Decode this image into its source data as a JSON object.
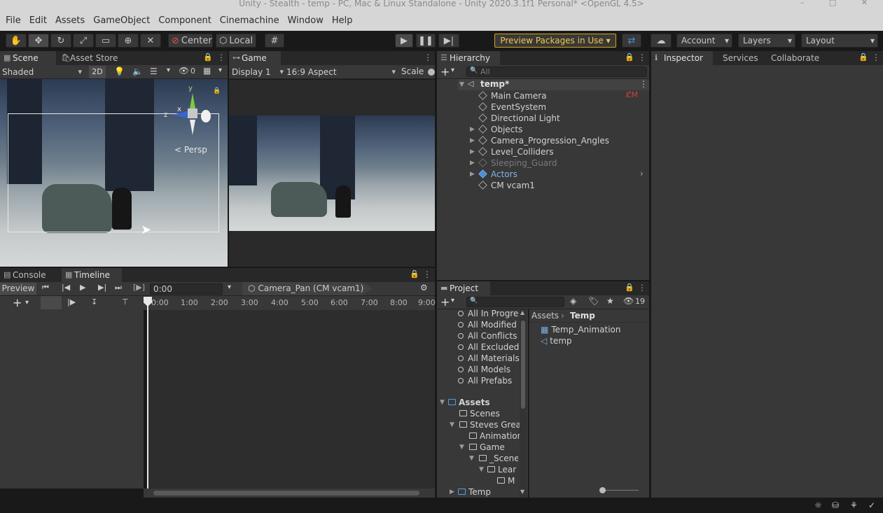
{
  "window": {
    "title": "Unity - Stealth - temp - PC, Mac & Linux Standalone - Unity 2020.3.1f1 Personal* <OpenGL 4.5>"
  },
  "menu": [
    "File",
    "Edit",
    "Assets",
    "GameObject",
    "Component",
    "Cinemachine",
    "Window",
    "Help"
  ],
  "toolbar": {
    "pivot": "Center",
    "space": "Local",
    "preview_packages": "Preview Packages in Use",
    "account": "Account",
    "layers": "Layers",
    "layout": "Layout"
  },
  "scene": {
    "tab_scene": "Scene",
    "tab_asset_store": "Asset Store",
    "shading": "Shaded",
    "mode_2d": "2D",
    "hidden_count": "0",
    "gizmo_y": "y",
    "gizmo_x": "x",
    "gizmo_z": "z",
    "persp": "< Persp"
  },
  "game": {
    "tab": "Game",
    "display": "Display 1",
    "aspect": "16:9 Aspect",
    "scale": "Scale"
  },
  "hierarchy": {
    "tab": "Hierarchy",
    "search_placeholder": "All",
    "scene_name": "temp*",
    "items": [
      {
        "label": "Main Camera",
        "expandable": false
      },
      {
        "label": "EventSystem",
        "expandable": false
      },
      {
        "label": "Directional Light",
        "expandable": false
      },
      {
        "label": "Objects",
        "expandable": true
      },
      {
        "label": "Camera_Progression_Angles",
        "expandable": true
      },
      {
        "label": "Level_Colliders",
        "expandable": true
      },
      {
        "label": "Sleeping_Guard",
        "expandable": true
      },
      {
        "label": "Actors",
        "expandable": true
      },
      {
        "label": "CM vcam1",
        "expandable": false
      }
    ]
  },
  "inspector": {
    "tab": "Inspector",
    "services": "Services",
    "collaborate": "Collaborate"
  },
  "timeline": {
    "tab_console": "Console",
    "tab_timeline": "Timeline",
    "preview": "Preview",
    "time": "0:00",
    "director": "Camera_Pan (CM vcam1)",
    "ruler": [
      "0:00",
      "1:00",
      "2:00",
      "3:00",
      "4:00",
      "5:00",
      "6:00",
      "7:00",
      "8:00",
      "9:00"
    ]
  },
  "project": {
    "tab": "Project",
    "hidden_count": "19",
    "favorites": [
      "All In Progre",
      "All Modified",
      "All Conflicts",
      "All Excluded",
      "All Materials",
      "All Models",
      "All Prefabs"
    ],
    "tree_root": "Assets",
    "tree": [
      "Scenes",
      "Steves Grea",
      "Animation",
      "Game",
      "_Scene",
      "Lear",
      "M",
      "Temp"
    ],
    "breadcrumb_root": "Assets",
    "breadcrumb_current": "Temp",
    "files": [
      "Temp_Animation",
      "temp"
    ]
  }
}
